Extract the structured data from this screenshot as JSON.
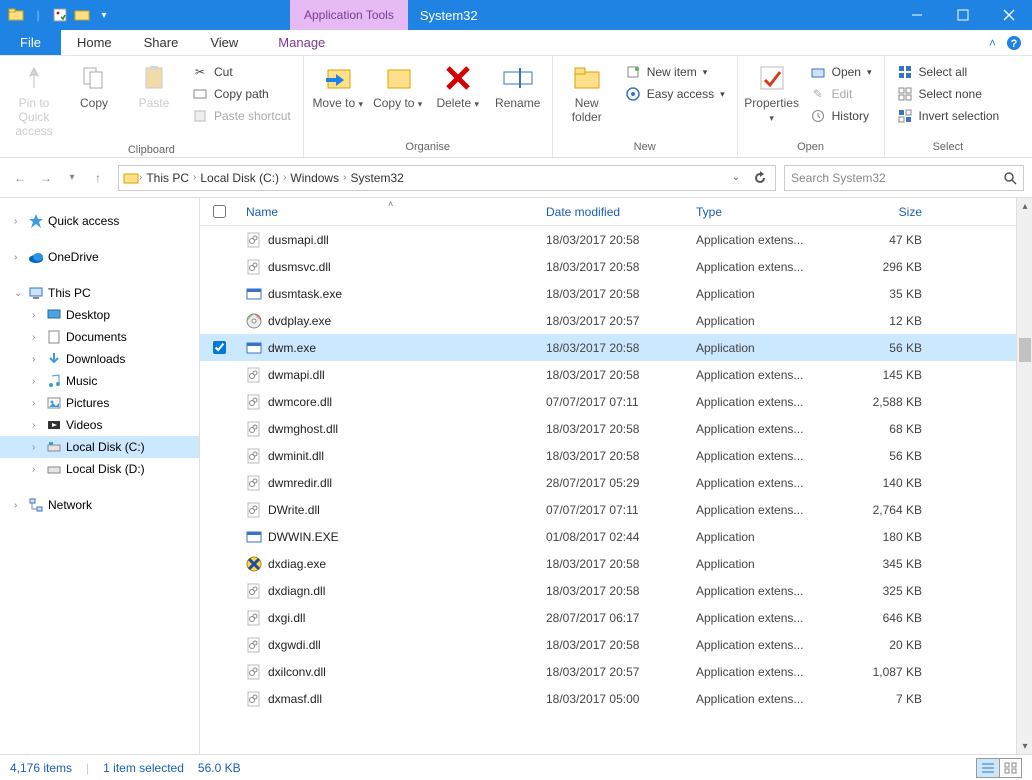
{
  "title_tab": "Application Tools",
  "window_title": "System32",
  "tabs": {
    "file": "File",
    "home": "Home",
    "share": "Share",
    "view": "View",
    "manage": "Manage"
  },
  "ribbon": {
    "clipboard": {
      "pin": "Pin to Quick access",
      "copy": "Copy",
      "paste": "Paste",
      "cut": "Cut",
      "copy_path": "Copy path",
      "paste_shortcut": "Paste shortcut",
      "label": "Clipboard"
    },
    "organise": {
      "move_to": "Move to",
      "copy_to": "Copy to",
      "delete": "Delete",
      "rename": "Rename",
      "label": "Organise"
    },
    "new": {
      "new_folder": "New folder",
      "new_item": "New item",
      "easy_access": "Easy access",
      "label": "New"
    },
    "open": {
      "properties": "Properties",
      "open": "Open",
      "edit": "Edit",
      "history": "History",
      "label": "Open"
    },
    "select": {
      "select_all": "Select all",
      "select_none": "Select none",
      "invert": "Invert selection",
      "label": "Select"
    }
  },
  "breadcrumbs": [
    "This PC",
    "Local Disk (C:)",
    "Windows",
    "System32"
  ],
  "search_placeholder": "Search System32",
  "tree": {
    "quick_access": "Quick access",
    "onedrive": "OneDrive",
    "this_pc": "This PC",
    "desktop": "Desktop",
    "documents": "Documents",
    "downloads": "Downloads",
    "music": "Music",
    "pictures": "Pictures",
    "videos": "Videos",
    "disk_c": "Local Disk (C:)",
    "disk_d": "Local Disk (D:)",
    "network": "Network"
  },
  "columns": {
    "name": "Name",
    "date": "Date modified",
    "type": "Type",
    "size": "Size"
  },
  "files": [
    {
      "name": "dusmapi.dll",
      "date": "18/03/2017 20:58",
      "type": "Application extens...",
      "size": "47 KB",
      "icon": "dll",
      "selected": false
    },
    {
      "name": "dusmsvc.dll",
      "date": "18/03/2017 20:58",
      "type": "Application extens...",
      "size": "296 KB",
      "icon": "dll",
      "selected": false
    },
    {
      "name": "dusmtask.exe",
      "date": "18/03/2017 20:58",
      "type": "Application",
      "size": "35 KB",
      "icon": "exe-blue",
      "selected": false
    },
    {
      "name": "dvdplay.exe",
      "date": "18/03/2017 20:57",
      "type": "Application",
      "size": "12 KB",
      "icon": "dvd",
      "selected": false
    },
    {
      "name": "dwm.exe",
      "date": "18/03/2017 20:58",
      "type": "Application",
      "size": "56 KB",
      "icon": "exe-blue",
      "selected": true
    },
    {
      "name": "dwmapi.dll",
      "date": "18/03/2017 20:58",
      "type": "Application extens...",
      "size": "145 KB",
      "icon": "dll",
      "selected": false
    },
    {
      "name": "dwmcore.dll",
      "date": "07/07/2017 07:11",
      "type": "Application extens...",
      "size": "2,588 KB",
      "icon": "dll",
      "selected": false
    },
    {
      "name": "dwmghost.dll",
      "date": "18/03/2017 20:58",
      "type": "Application extens...",
      "size": "68 KB",
      "icon": "dll",
      "selected": false
    },
    {
      "name": "dwminit.dll",
      "date": "18/03/2017 20:58",
      "type": "Application extens...",
      "size": "56 KB",
      "icon": "dll",
      "selected": false
    },
    {
      "name": "dwmredir.dll",
      "date": "28/07/2017 05:29",
      "type": "Application extens...",
      "size": "140 KB",
      "icon": "dll",
      "selected": false
    },
    {
      "name": "DWrite.dll",
      "date": "07/07/2017 07:11",
      "type": "Application extens...",
      "size": "2,764 KB",
      "icon": "dll",
      "selected": false
    },
    {
      "name": "DWWIN.EXE",
      "date": "01/08/2017 02:44",
      "type": "Application",
      "size": "180 KB",
      "icon": "exe-blue",
      "selected": false
    },
    {
      "name": "dxdiag.exe",
      "date": "18/03/2017 20:58",
      "type": "Application",
      "size": "345 KB",
      "icon": "dxdiag",
      "selected": false
    },
    {
      "name": "dxdiagn.dll",
      "date": "18/03/2017 20:58",
      "type": "Application extens...",
      "size": "325 KB",
      "icon": "dll",
      "selected": false
    },
    {
      "name": "dxgi.dll",
      "date": "28/07/2017 06:17",
      "type": "Application extens...",
      "size": "646 KB",
      "icon": "dll",
      "selected": false
    },
    {
      "name": "dxgwdi.dll",
      "date": "18/03/2017 20:58",
      "type": "Application extens...",
      "size": "20 KB",
      "icon": "dll",
      "selected": false
    },
    {
      "name": "dxilconv.dll",
      "date": "18/03/2017 20:57",
      "type": "Application extens...",
      "size": "1,087 KB",
      "icon": "dll",
      "selected": false
    },
    {
      "name": "dxmasf.dll",
      "date": "18/03/2017 05:00",
      "type": "Application extens...",
      "size": "7 KB",
      "icon": "dll",
      "selected": false
    }
  ],
  "status": {
    "items": "4,176 items",
    "selected": "1 item selected",
    "size": "56.0 KB"
  }
}
